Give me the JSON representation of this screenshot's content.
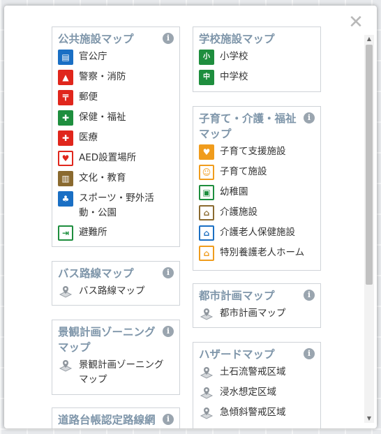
{
  "close_label": "✕",
  "panels": {
    "public": {
      "title": "公共施設マップ",
      "items": [
        "官公庁",
        "警察・消防",
        "郵便",
        "保健・福祉",
        "医療",
        "AED設置場所",
        "文化・教育",
        "スポーツ・野外活動・公園",
        "避難所"
      ]
    },
    "bus": {
      "title": "バス路線マップ",
      "items": [
        "バス路線マップ"
      ]
    },
    "landscape": {
      "title": "景観計画ゾーニングマップ",
      "items": [
        "景観計画ゾーニングマップ"
      ]
    },
    "road": {
      "title": "道路台帳認定路線網"
    },
    "school": {
      "title": "学校施設マップ",
      "items": [
        "小学校",
        "中学校"
      ]
    },
    "care": {
      "title": "子育て・介護・福祉マップ",
      "items": [
        "子育て支援施設",
        "子育て施設",
        "幼稚園",
        "介護施設",
        "介護老人保健施設",
        "特別養護老人ホーム"
      ]
    },
    "urban": {
      "title": "都市計画マップ",
      "items": [
        "都市計画マップ"
      ]
    },
    "hazard": {
      "title": "ハザードマップ",
      "items": [
        "土石流警戒区域",
        "浸水想定区域",
        "急傾斜警戒区域"
      ]
    }
  },
  "icons": {
    "info": "info-icon",
    "pin": "map-pin-icon"
  },
  "colors": {
    "title": "#7f96aa",
    "blue": "#1a6fc4",
    "red": "#e0261c",
    "green": "#1e8e3e",
    "brown": "#8a6a2f",
    "orange": "#f09c1c"
  }
}
